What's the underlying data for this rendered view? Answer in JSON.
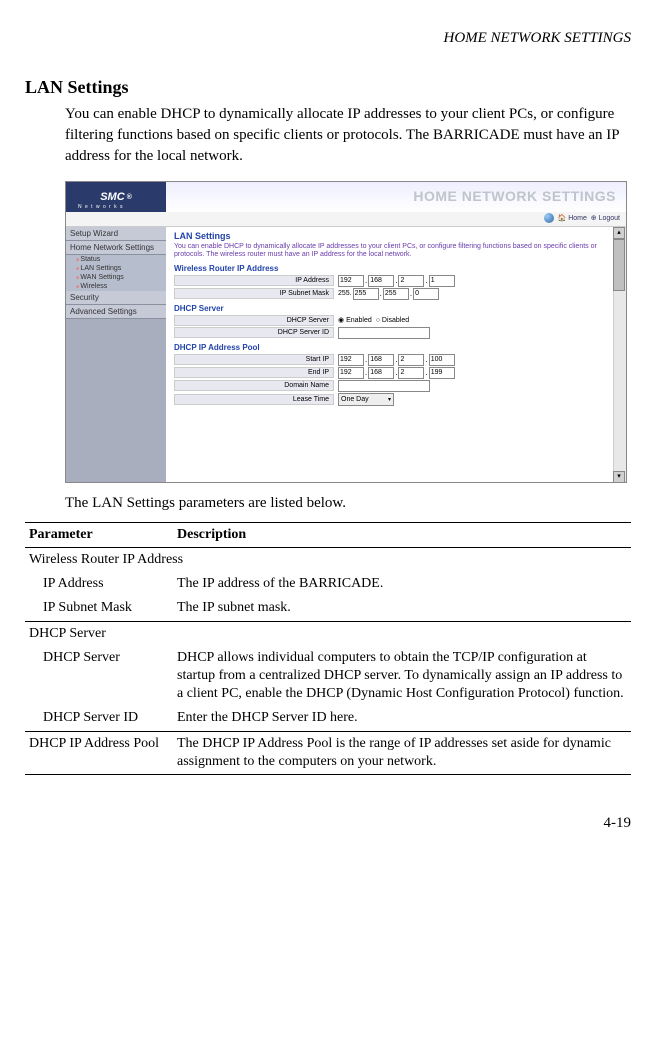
{
  "page_header": "HOME NETWORK SETTINGS",
  "title": "LAN Settings",
  "intro": "You can enable DHCP to dynamically allocate IP addresses to your client PCs, or configure filtering functions based on specific clients or protocols. The BARRICADE must have an IP address for the local network.",
  "screenshot": {
    "logo": "SMC",
    "logo_reg": "®",
    "logo_sub": "N e t w o r k s",
    "banner": "HOME NETWORK SETTINGS",
    "toolbar": {
      "home": "Home",
      "logout": "Logout"
    },
    "sidebar": {
      "setup_wizard": "Setup Wizard",
      "home_net": "Home Network Settings",
      "status": "Status",
      "lan": "LAN Settings",
      "wan": "WAN Settings",
      "wireless": "Wireless",
      "security": "Security",
      "advanced": "Advanced Settings"
    },
    "content": {
      "title": "LAN Settings",
      "desc": "You can enable DHCP to dynamically allocate IP addresses to your client PCs, or configure filtering functions based on specific clients or protocols. The wireless router must have an IP address for the local network.",
      "sec1": "Wireless Router IP Address",
      "ip_address_label": "IP Address",
      "ip": [
        "192",
        "168",
        "2",
        "1"
      ],
      "subnet_label": "IP Subnet Mask",
      "subnet": [
        "255",
        "255",
        "255",
        "0"
      ],
      "subnet_prefix": "255.",
      "sec2": "DHCP Server",
      "dhcp_server_label": "DHCP Server",
      "enabled": "Enabled",
      "disabled": "Disabled",
      "dhcp_id_label": "DHCP Server ID",
      "sec3": "DHCP IP Address Pool",
      "start_ip_label": "Start IP",
      "start_ip": [
        "192",
        "168",
        "2",
        "100"
      ],
      "end_ip_label": "End IP",
      "end_ip": [
        "192",
        "168",
        "2",
        "199"
      ],
      "domain_label": "Domain Name",
      "lease_label": "Lease Time",
      "lease_value": "One Day"
    }
  },
  "caption": "The LAN Settings parameters are listed below.",
  "table": {
    "h1": "Parameter",
    "h2": "Description",
    "sec1": "Wireless Router IP Address",
    "p1": "IP Address",
    "d1": "The IP address of the BARRICADE.",
    "p2": "IP Subnet Mask",
    "d2": "The IP subnet mask.",
    "sec2": "DHCP Server",
    "p3": "DHCP Server",
    "d3": "DHCP allows individual computers to obtain the TCP/IP configuration at startup from a centralized DHCP server. To dynamically assign an IP address to a client PC, enable the DHCP (Dynamic Host Configuration Protocol) function.",
    "p4": "DHCP Server ID",
    "d4": "Enter the DHCP Server ID here.",
    "p5": "DHCP IP Address Pool",
    "d5": "The DHCP IP Address Pool is the range of IP addresses set aside for dynamic assignment to the computers on your network."
  },
  "page_num": "4-19"
}
